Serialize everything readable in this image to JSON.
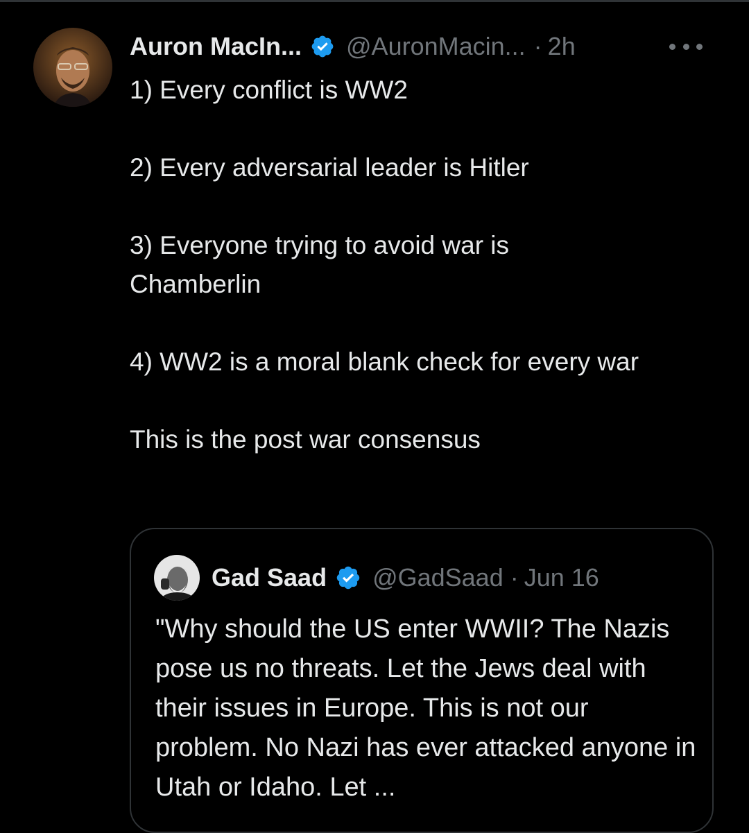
{
  "tweet": {
    "author_name": "Auron MacIn...",
    "handle": "@AuronMacin...",
    "separator": "·",
    "time": "2h",
    "more_icon": "more-horizontal-icon",
    "verified_icon": "verified-badge-icon",
    "paragraphs": [
      "1) Every conflict is WW2",
      "2) Every adversarial leader is Hitler",
      "3) Everyone trying to avoid war is Chamberlin",
      "4) WW2 is a moral blank check for every war",
      "This is the post war consensus"
    ]
  },
  "quoted_tweet": {
    "author_name": "Gad Saad",
    "handle": "@GadSaad",
    "separator": "·",
    "date": "Jun 16",
    "verified_icon": "verified-badge-icon",
    "text": "\"Why should the US enter WWII?  The Nazis pose us no threats.  Let the Jews deal with their issues in Europe.  This is not our problem.  No Nazi has ever attacked anyone in Utah or Idaho.  Let ..."
  },
  "colors": {
    "background": "#000000",
    "primary_text": "#e7e9ea",
    "secondary_text": "#71767b",
    "verified_blue": "#1d9bf0",
    "border": "#2f3336"
  }
}
